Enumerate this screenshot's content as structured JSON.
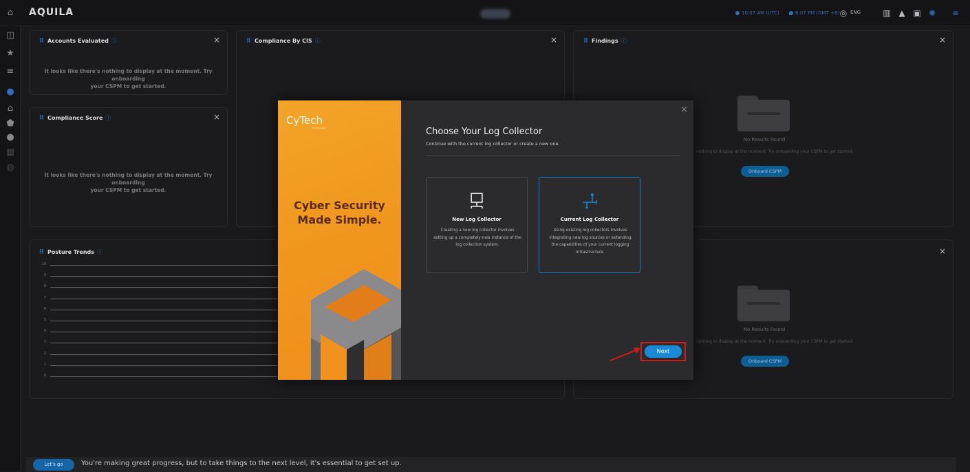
{
  "topbar": {
    "brand": "AQUILA",
    "clock_utc": "10:07 AM (UTC)",
    "clock_local": "6:07 PM (GMT +8)",
    "language": "ENG",
    "icons": [
      "home-icon",
      "globe-icon",
      "building-icon",
      "bell-icon",
      "calculator-icon",
      "support-icon",
      "menu-icon"
    ]
  },
  "sidebar": {
    "icons": [
      "panel-icon",
      "star-icon",
      "list-icon",
      "cloud-icon",
      "bank-icon",
      "shield-icon",
      "badge-icon",
      "grid-icon",
      "database-icon"
    ]
  },
  "panels": {
    "accounts_evaluated": {
      "title": "Accounts Evaluated",
      "empty_line1": "It looks like there's nothing to display at the moment. Try onboarding",
      "empty_line2": "your CSPM to get started."
    },
    "compliance_by_cis": {
      "title": "Compliance By CIS"
    },
    "findings": {
      "title": "Findings",
      "no_results": "No Results Found",
      "message": "nothing to display at the moment. Try onboarding your CSPM to get started.",
      "button": "Onboard CSPM"
    },
    "compliance_score": {
      "title": "Compliance Score",
      "empty_line1": "It looks like there's nothing to display at the moment. Try onboarding",
      "empty_line2": "your CSPM to get started."
    },
    "posture_trends": {
      "title": "Posture Trends",
      "y_ticks": [
        "10",
        "9",
        "8",
        "7",
        "6",
        "5",
        "4",
        "3",
        "2",
        "1",
        "0"
      ]
    },
    "lower_right": {
      "no_results": "No Results Found",
      "message": "nothing to display at the moment. Try onboarding your CSPM to get started.",
      "button": "Onboard CSPM"
    }
  },
  "modal": {
    "logo": "CyTech",
    "logo_sub": "Technologies",
    "tagline_line1": "Cyber Security",
    "tagline_line2": "Made Simple.",
    "title": "Choose Your Log Collector",
    "subtitle": "Continue with the current log collector or create a new one.",
    "close": "×",
    "options": [
      {
        "title": "New Log Collector",
        "description": "Creating a new log collector involves setting up a completely new instance of the log collection system.",
        "icon": "monitor-icon"
      },
      {
        "title": "Current Log Collector",
        "description": "Using existing log collectors involves integrating new log sources or extending the capabilities of your current logging infrastructure.",
        "icon": "network-icon"
      }
    ],
    "next_label": "Next"
  },
  "banner": {
    "button": "Let's go",
    "text": "You're making great progress, but to take things to the next level, it's essential to get set up."
  },
  "colors": {
    "accent": "#1a8ad6",
    "highlight_red": "#d21b1b",
    "orange": "#f2a428"
  }
}
